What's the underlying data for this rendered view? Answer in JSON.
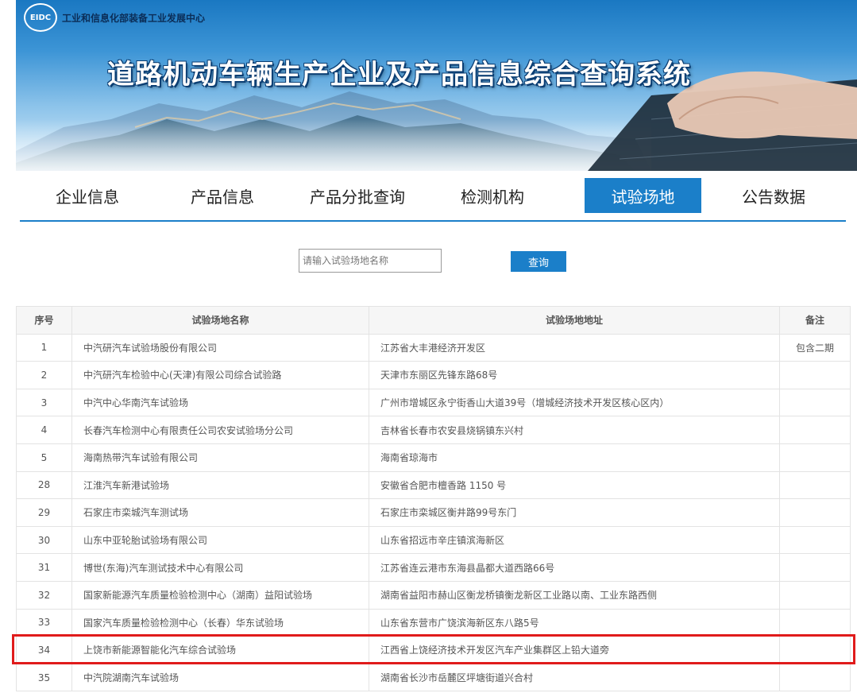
{
  "header": {
    "org_logo_text": "EIDC",
    "org_name": "工业和信息化部装备工业发展中心",
    "system_title": "道路机动车辆生产企业及产品信息综合查询系统"
  },
  "nav": {
    "items": [
      {
        "label": "企业信息"
      },
      {
        "label": "产品信息"
      },
      {
        "label": "产品分批查询"
      },
      {
        "label": "检测机构"
      },
      {
        "label": "试验场地"
      },
      {
        "label": "公告数据"
      }
    ],
    "active_index": 4
  },
  "search": {
    "placeholder": "请输入试验场地名称",
    "button_label": "查询"
  },
  "table": {
    "columns": [
      "序号",
      "试验场地名称",
      "试验场地地址",
      "备注"
    ],
    "rows": [
      {
        "no": "1",
        "name": "中汽研汽车试验场股份有限公司",
        "address": "江苏省大丰港经济开发区",
        "note": "包含二期"
      },
      {
        "no": "2",
        "name": "中汽研汽车检验中心(天津)有限公司综合试验路",
        "address": "天津市东丽区先锋东路68号",
        "note": ""
      },
      {
        "no": "3",
        "name": "中汽中心华南汽车试验场",
        "address": "广州市增城区永宁街香山大道39号（增城经济技术开发区核心区内）",
        "note": ""
      },
      {
        "no": "4",
        "name": "长春汽车检测中心有限责任公司农安试验场分公司",
        "address": "吉林省长春市农安县烧锅镇东兴村",
        "note": ""
      },
      {
        "no": "5",
        "name": "海南热带汽车试验有限公司",
        "address": "海南省琼海市",
        "note": ""
      },
      {
        "no": "28",
        "name": "江淮汽车新港试验场",
        "address": "安徽省合肥市檀香路 1150 号",
        "note": ""
      },
      {
        "no": "29",
        "name": "石家庄市栾城汽车测试场",
        "address": "石家庄市栾城区衡井路99号东门",
        "note": ""
      },
      {
        "no": "30",
        "name": "山东中亚轮胎试验场有限公司",
        "address": "山东省招远市辛庄镇滨海新区",
        "note": ""
      },
      {
        "no": "31",
        "name": "博世(东海)汽车测试技术中心有限公司",
        "address": "江苏省连云港市东海县晶都大道西路66号",
        "note": ""
      },
      {
        "no": "32",
        "name": "国家新能源汽车质量检验检测中心（湖南）益阳试验场",
        "address": "湖南省益阳市赫山区衡龙桥镇衡龙新区工业路以南、工业东路西侧",
        "note": ""
      },
      {
        "no": "33",
        "name": "国家汽车质量检验检测中心（长春）华东试验场",
        "address": "山东省东营市广饶滨海新区东八路5号",
        "note": ""
      },
      {
        "no": "34",
        "name": "上饶市新能源智能化汽车综合试验场",
        "address": "江西省上饶经济技术开发区汽车产业集群区上铅大道旁",
        "note": ""
      },
      {
        "no": "35",
        "name": "中汽院湖南汽车试验场",
        "address": "湖南省长沙市岳麓区坪塘街道兴合村",
        "note": ""
      }
    ],
    "highlighted_row_no": "34"
  },
  "colors": {
    "accent": "#1b7fc9",
    "highlight": "#e01b1b",
    "header_bg": "#f6f6f6"
  }
}
